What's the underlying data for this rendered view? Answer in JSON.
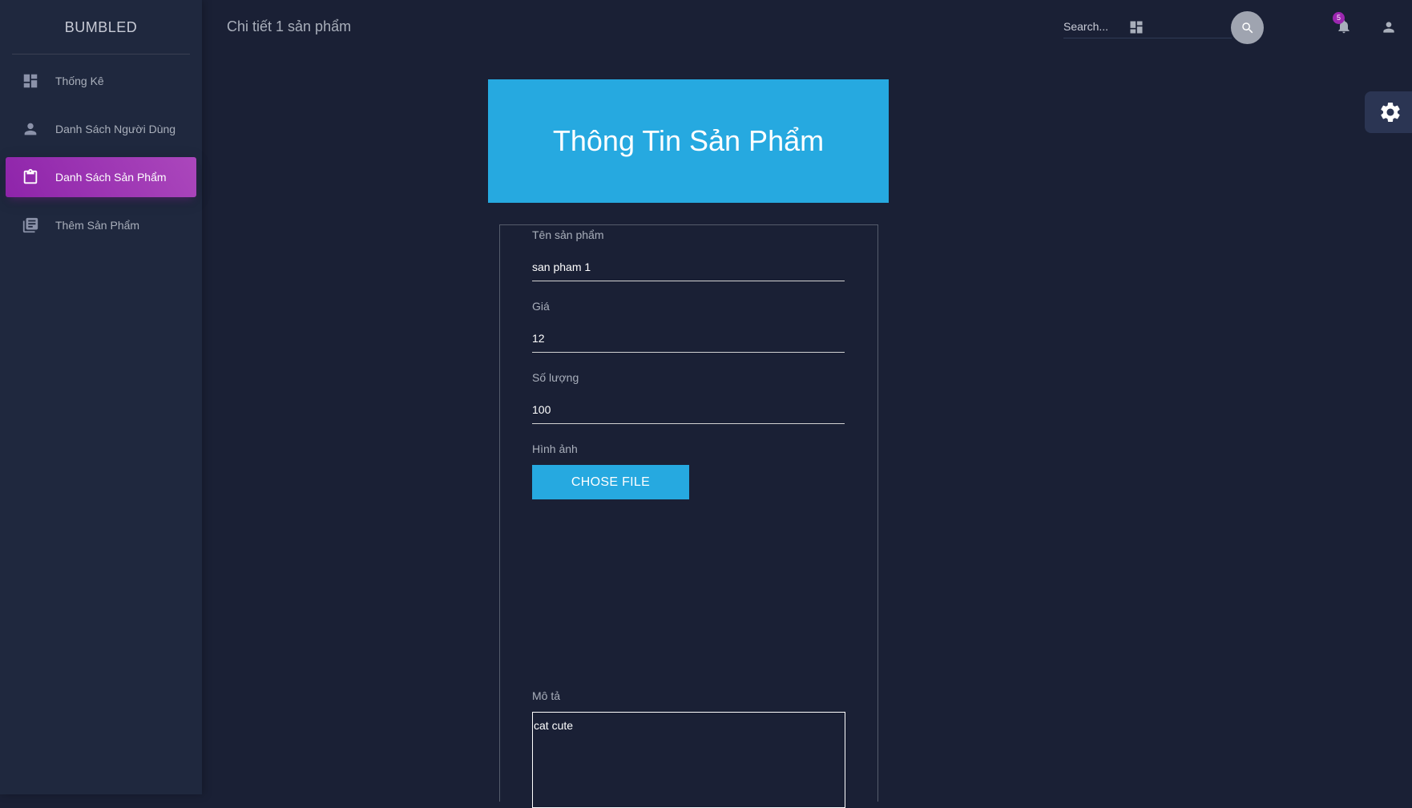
{
  "sidebar": {
    "brand": "BUMBLED",
    "items": [
      {
        "label": "Thống Kê",
        "icon": "dashboard-icon"
      },
      {
        "label": "Danh Sách Người Dùng",
        "icon": "person-icon"
      },
      {
        "label": "Danh Sách Sản Phẩm",
        "icon": "clipboard-icon",
        "active": true
      },
      {
        "label": "Thêm Sản Phẩm",
        "icon": "library-books-icon"
      }
    ]
  },
  "header": {
    "title": "Chi tiết 1 sản phẩm",
    "search_placeholder": "Search...",
    "notification_count": "5"
  },
  "card": {
    "title": "Thông Tin Sản Phẩm"
  },
  "form": {
    "name_label": "Tên sản phẩm",
    "name_value": "san pham 1",
    "price_label": "Giá",
    "price_value": "12",
    "quantity_label": "Số lượng",
    "quantity_value": "100",
    "image_label": "Hình ảnh",
    "file_button": "CHOSE FILE",
    "description_label": "Mô tả",
    "description_value": "cat cute"
  },
  "colors": {
    "background": "#1a2035",
    "sidebar": "#1f283e",
    "active_item": "#9c27b0",
    "accent": "#26a9e0"
  }
}
